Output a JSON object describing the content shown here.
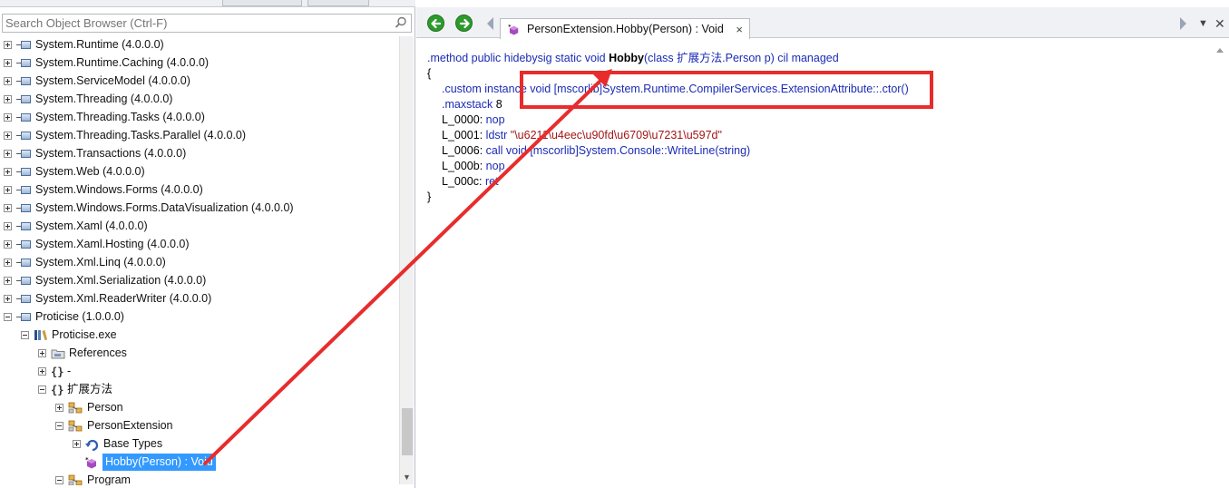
{
  "search": {
    "placeholder": "Search Object Browser (Ctrl-F)"
  },
  "tree": {
    "items": [
      {
        "label": "System.Runtime (4.0.0.0)"
      },
      {
        "label": "System.Runtime.Caching (4.0.0.0)"
      },
      {
        "label": "System.ServiceModel (4.0.0.0)"
      },
      {
        "label": "System.Threading (4.0.0.0)"
      },
      {
        "label": "System.Threading.Tasks (4.0.0.0)"
      },
      {
        "label": "System.Threading.Tasks.Parallel (4.0.0.0)"
      },
      {
        "label": "System.Transactions (4.0.0.0)"
      },
      {
        "label": "System.Web (4.0.0.0)"
      },
      {
        "label": "System.Windows.Forms (4.0.0.0)"
      },
      {
        "label": "System.Windows.Forms.DataVisualization (4.0.0.0)"
      },
      {
        "label": "System.Xaml (4.0.0.0)"
      },
      {
        "label": "System.Xaml.Hosting (4.0.0.0)"
      },
      {
        "label": "System.Xml.Linq (4.0.0.0)"
      },
      {
        "label": "System.Xml.Serialization (4.0.0.0)"
      },
      {
        "label": "System.Xml.ReaderWriter (4.0.0.0)"
      },
      {
        "label": "Proticise (1.0.0.0)"
      },
      {
        "label": "Proticise.exe"
      },
      {
        "label": "References"
      },
      {
        "label": "-"
      },
      {
        "label": "扩展方法"
      },
      {
        "label": "Person"
      },
      {
        "label": "PersonExtension"
      },
      {
        "label": "Base Types"
      },
      {
        "label": "Hobby(Person) : Void"
      },
      {
        "label": "Program"
      }
    ]
  },
  "tab": {
    "label": "PersonExtension.Hobby(Person) : Void",
    "close": "×"
  },
  "code": {
    "l1": {
      "a": ".method public hidebysig static void ",
      "b": "Hobby",
      "c": "(class ",
      "d": "扩展方法.Person",
      "e": " p) cil managed"
    },
    "l2": "{",
    "l3": {
      "a": ".custom instance void ",
      "b": "[mscorlib]System.Runtime.CompilerServices.ExtensionAttribute::.ctor()"
    },
    "l4": {
      "a": ".maxstack ",
      "b": "8"
    },
    "l5": {
      "a": "L_0000: ",
      "b": "nop"
    },
    "l6": {
      "a": "L_0001: ",
      "b": "ldstr ",
      "c": "\"\\u6211\\u4eec\\u90fd\\u6709\\u7231\\u597d\""
    },
    "l7": {
      "a": "L_0006: ",
      "b": "call ",
      "c": "void ",
      "d": "[mscorlib]System.Console::WriteLine(string)"
    },
    "l8": {
      "a": "L_000b: ",
      "b": "nop"
    },
    "l9": {
      "a": "L_000c: ",
      "b": "ret"
    },
    "l10": "}"
  },
  "colors": {
    "annotation": "#e82c2c",
    "selection": "#3399ff",
    "keyword": "#1c2bb5",
    "string": "#a31515",
    "nav_green": "#2e9a2e"
  }
}
